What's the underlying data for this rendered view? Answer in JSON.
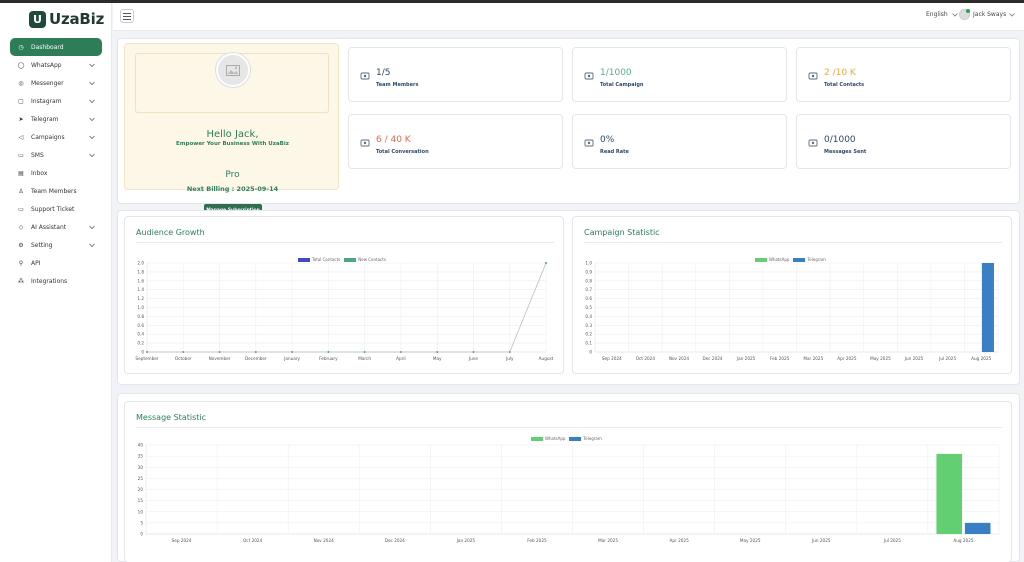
{
  "brand": {
    "name": "UzaBiz",
    "mark": "U"
  },
  "header": {
    "language": "English",
    "user_name": "Jack Sways"
  },
  "sidebar": {
    "items": [
      {
        "label": "Dashboard",
        "icon": "dashboard-icon",
        "active": true,
        "has_children": false
      },
      {
        "label": "WhatsApp",
        "icon": "whatsapp-icon",
        "has_children": true
      },
      {
        "label": "Messenger",
        "icon": "messenger-icon",
        "has_children": true
      },
      {
        "label": "Instagram",
        "icon": "instagram-icon",
        "has_children": true
      },
      {
        "label": "Telegram",
        "icon": "telegram-icon",
        "has_children": true
      },
      {
        "label": "Campaigns",
        "icon": "megaphone-icon",
        "has_children": true
      },
      {
        "label": "SMS",
        "icon": "sms-icon",
        "has_children": true
      },
      {
        "label": "Inbox",
        "icon": "inbox-icon",
        "has_children": false
      },
      {
        "label": "Team Members",
        "icon": "user-icon",
        "has_children": false
      },
      {
        "label": "Support Ticket",
        "icon": "ticket-icon",
        "has_children": false
      },
      {
        "label": "AI Assistant",
        "icon": "ai-icon",
        "has_children": true
      },
      {
        "label": "Setting",
        "icon": "gear-icon",
        "has_children": true
      },
      {
        "label": "API",
        "icon": "api-icon",
        "has_children": false
      },
      {
        "label": "Integrations",
        "icon": "integrations-icon",
        "has_children": false
      }
    ]
  },
  "welcome": {
    "greeting": "Hello Jack,",
    "tagline": "Empower Your Business With UzaBiz",
    "plan": "Pro",
    "billing": "Next Billing : 2025-09-14",
    "manage_label": "Manage Subscription"
  },
  "stats": [
    {
      "value": "1/5",
      "label": "Team Members",
      "color": "#2d4a6a",
      "icon": "team-icon"
    },
    {
      "value": "1/1000",
      "label": "Total Campaign",
      "color": "#52b08a",
      "icon": "campaign-icon"
    },
    {
      "value": "2 /10 K",
      "label": "Total Contacts",
      "color": "#f0a93a",
      "icon": "contacts-icon"
    },
    {
      "value": "6 / 40 K",
      "label": "Total Conversation",
      "color": "#e4684e",
      "icon": "conversation-icon"
    },
    {
      "value": "0%",
      "label": "Read Rate",
      "color": "#2d4a6a",
      "icon": "mail-icon"
    },
    {
      "value": "0/1000",
      "label": "Messages Sent",
      "color": "#2d4a6a",
      "icon": "messages-icon"
    }
  ],
  "colors": {
    "accent": "#2e7d59",
    "whatsapp": "#63cf73",
    "telegram": "#3a7fc4",
    "total_contacts": "#3f4cc9",
    "new_contacts": "#4fa58a"
  },
  "chart_data": [
    {
      "type": "line",
      "title": "Audience Growth",
      "categories": [
        "September",
        "October",
        "November",
        "December",
        "January",
        "February",
        "March",
        "April",
        "May",
        "June",
        "July",
        "August"
      ],
      "series": [
        {
          "name": "Total Contacts",
          "values": [
            0,
            0,
            0,
            0,
            0,
            0,
            0,
            0,
            0,
            0,
            0,
            2
          ]
        },
        {
          "name": "New Contacts",
          "values": [
            0,
            0,
            0,
            0,
            0,
            0,
            0,
            0,
            0,
            0,
            0,
            2
          ]
        }
      ],
      "ylim": [
        0,
        2.0
      ],
      "yticks": [
        "0",
        "0.2",
        "0.4",
        "0.6",
        "0.8",
        "1.0",
        "1.2",
        "1.4",
        "1.6",
        "1.8",
        "2.0"
      ],
      "legend": "top-center",
      "grid": true
    },
    {
      "type": "bar",
      "title": "Campaign Statistic",
      "categories": [
        "Sep 2024",
        "Oct 2024",
        "Nov 2024",
        "Dec 2024",
        "Jan 2025",
        "Feb 2025",
        "Mar 2025",
        "Apr 2025",
        "May 2025",
        "Jun 2025",
        "Jul 2025",
        "Aug 2025"
      ],
      "series": [
        {
          "name": "WhatsApp",
          "values": [
            0,
            0,
            0,
            0,
            0,
            0,
            0,
            0,
            0,
            0,
            0,
            0
          ]
        },
        {
          "name": "Telegram",
          "values": [
            0,
            0,
            0,
            0,
            0,
            0,
            0,
            0,
            0,
            0,
            0,
            1
          ]
        }
      ],
      "ylim": [
        0,
        1.0
      ],
      "yticks": [
        "0",
        "0.1",
        "0.2",
        "0.3",
        "0.4",
        "0.5",
        "0.6",
        "0.7",
        "0.8",
        "0.9",
        "1.0"
      ],
      "legend": "top-center",
      "grid": true
    },
    {
      "type": "bar",
      "title": "Message Statistic",
      "categories": [
        "Sep 2024",
        "Oct 2024",
        "Nov 2024",
        "Dec 2024",
        "Jan 2025",
        "Feb 2025",
        "Mar 2025",
        "Apr 2025",
        "May 2025",
        "Jun 2025",
        "Jul 2025",
        "Aug 2025"
      ],
      "series": [
        {
          "name": "WhatsApp",
          "values": [
            0,
            0,
            0,
            0,
            0,
            0,
            0,
            0,
            0,
            0,
            0,
            36
          ]
        },
        {
          "name": "Telegram",
          "values": [
            0,
            0,
            0,
            0,
            0,
            0,
            0,
            0,
            0,
            0,
            0,
            5
          ]
        }
      ],
      "ylim": [
        0,
        40
      ],
      "yticks": [
        "0",
        "5",
        "10",
        "15",
        "20",
        "25",
        "30",
        "35",
        "40"
      ],
      "legend": "top-center",
      "grid": true
    }
  ]
}
